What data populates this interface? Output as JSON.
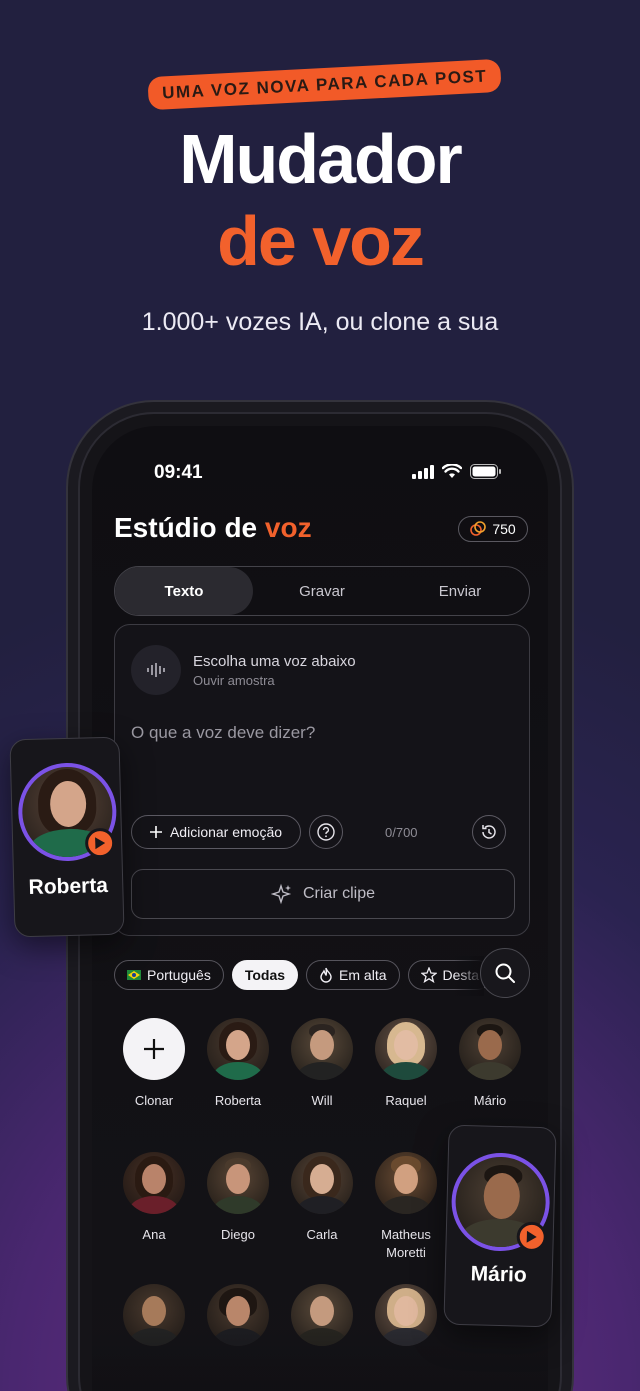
{
  "hero": {
    "tagline": "UMA VOZ NOVA PARA CADA POST",
    "title_line1": "Mudador",
    "title_line2": "de voz",
    "subtitle": "1.000+ vozes IA, ou clone a sua"
  },
  "status_bar": {
    "time": "09:41"
  },
  "studio": {
    "title_plain": "Estúdio de ",
    "title_accent": "voz",
    "credits": "750",
    "accent_color": "#f2612c"
  },
  "tabs": [
    {
      "label": "Texto",
      "active": true
    },
    {
      "label": "Gravar",
      "active": false
    },
    {
      "label": "Enviar",
      "active": false
    }
  ],
  "editor": {
    "voice_title": "Escolha uma voz abaixo",
    "voice_sub": "Ouvir amostra",
    "placeholder": "O que a voz deve dizer?",
    "emotion_button": "Adicionar emoção",
    "char_count": "0/700",
    "create_button": "Criar clipe"
  },
  "filters": [
    {
      "label": "Português",
      "icon": "brazil-flag-icon",
      "active": false
    },
    {
      "label": "Todas",
      "icon": "",
      "active": true
    },
    {
      "label": "Em alta",
      "icon": "flame-icon",
      "active": false
    },
    {
      "label": "Desta",
      "icon": "star-icon",
      "active": false
    }
  ],
  "voices": [
    {
      "name": "Clonar",
      "type": "add"
    },
    {
      "name": "Roberta"
    },
    {
      "name": "Will"
    },
    {
      "name": "Raquel"
    },
    {
      "name": "Mário"
    },
    {
      "name": "Ana"
    },
    {
      "name": "Diego"
    },
    {
      "name": "Carla"
    },
    {
      "name": "Matheus Moretti"
    }
  ],
  "cards": {
    "left_name": "Roberta",
    "right_name": "Mário"
  }
}
